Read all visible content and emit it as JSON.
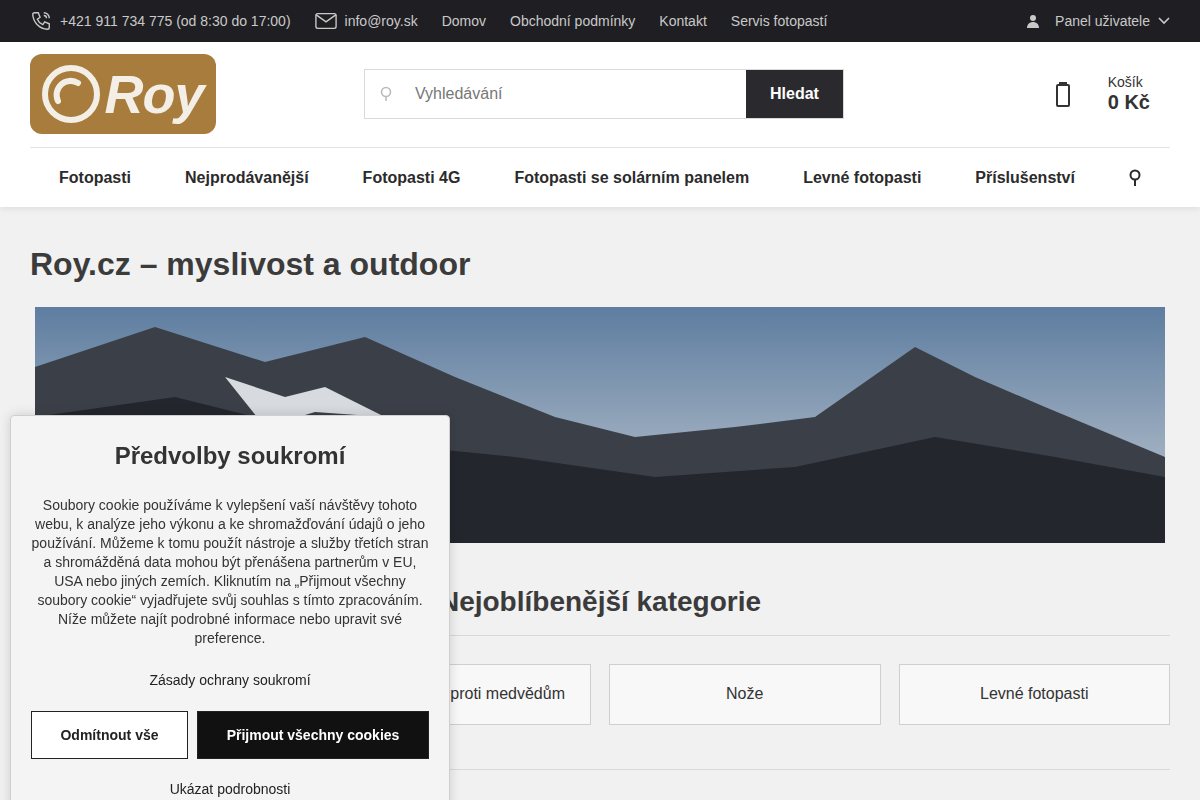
{
  "topbar": {
    "phone": "+421 911 734 775 (od 8:30 do 17:00)",
    "email": "info@roy.sk",
    "links": [
      "Domov",
      "Obchodní podmínky",
      "Kontakt",
      "Servis fotopastí"
    ],
    "user_panel": "Panel uživatele"
  },
  "logo": {
    "text": "Roy"
  },
  "search": {
    "placeholder": "Vyhledávání",
    "button": "Hledat"
  },
  "cart": {
    "label": "Košík",
    "total": "0 Kč"
  },
  "nav": {
    "items": [
      "Fotopasti",
      "Nejprodávanější",
      "Fotopasti 4G",
      "Fotopasti se solárním panelem",
      "Levné fotopasti",
      "Příslušenství"
    ]
  },
  "page": {
    "title": "Roy.cz – myslivost a outdoor"
  },
  "categories": {
    "title": "Nejoblíbenější kategorie",
    "items": [
      {
        "label": "ej proti medvědům",
        "kind": "cut"
      },
      {
        "label": "Nože",
        "kind": "full"
      },
      {
        "label": "Levné fotopasti",
        "kind": "full"
      }
    ]
  },
  "cookie": {
    "title": "Předvolby soukromí",
    "text": "Soubory cookie používáme k vylepšení vaší návštěvy tohoto webu, k analýze jeho výkonu a ke shromažďování údajů o jeho používání. Můžeme k tomu použít nástroje a služby třetích stran a shromážděná data mohou být přenášena partnerům v EU, USA nebo jiných zemích. Kliknutím na „Přijmout všechny soubory cookie“ vyjadřujete svůj souhlas s tímto zpracováním. Níže můžete najít podrobné informace nebo upravit své preference.",
    "policy": "Zásady ochrany soukromí",
    "buttons": [
      {
        "label": "Odmítnout vše",
        "kind": "outline"
      },
      {
        "label": "Přijmout všechny cookies",
        "kind": "primary"
      }
    ],
    "details": "Ukázat podrobnosti"
  }
}
